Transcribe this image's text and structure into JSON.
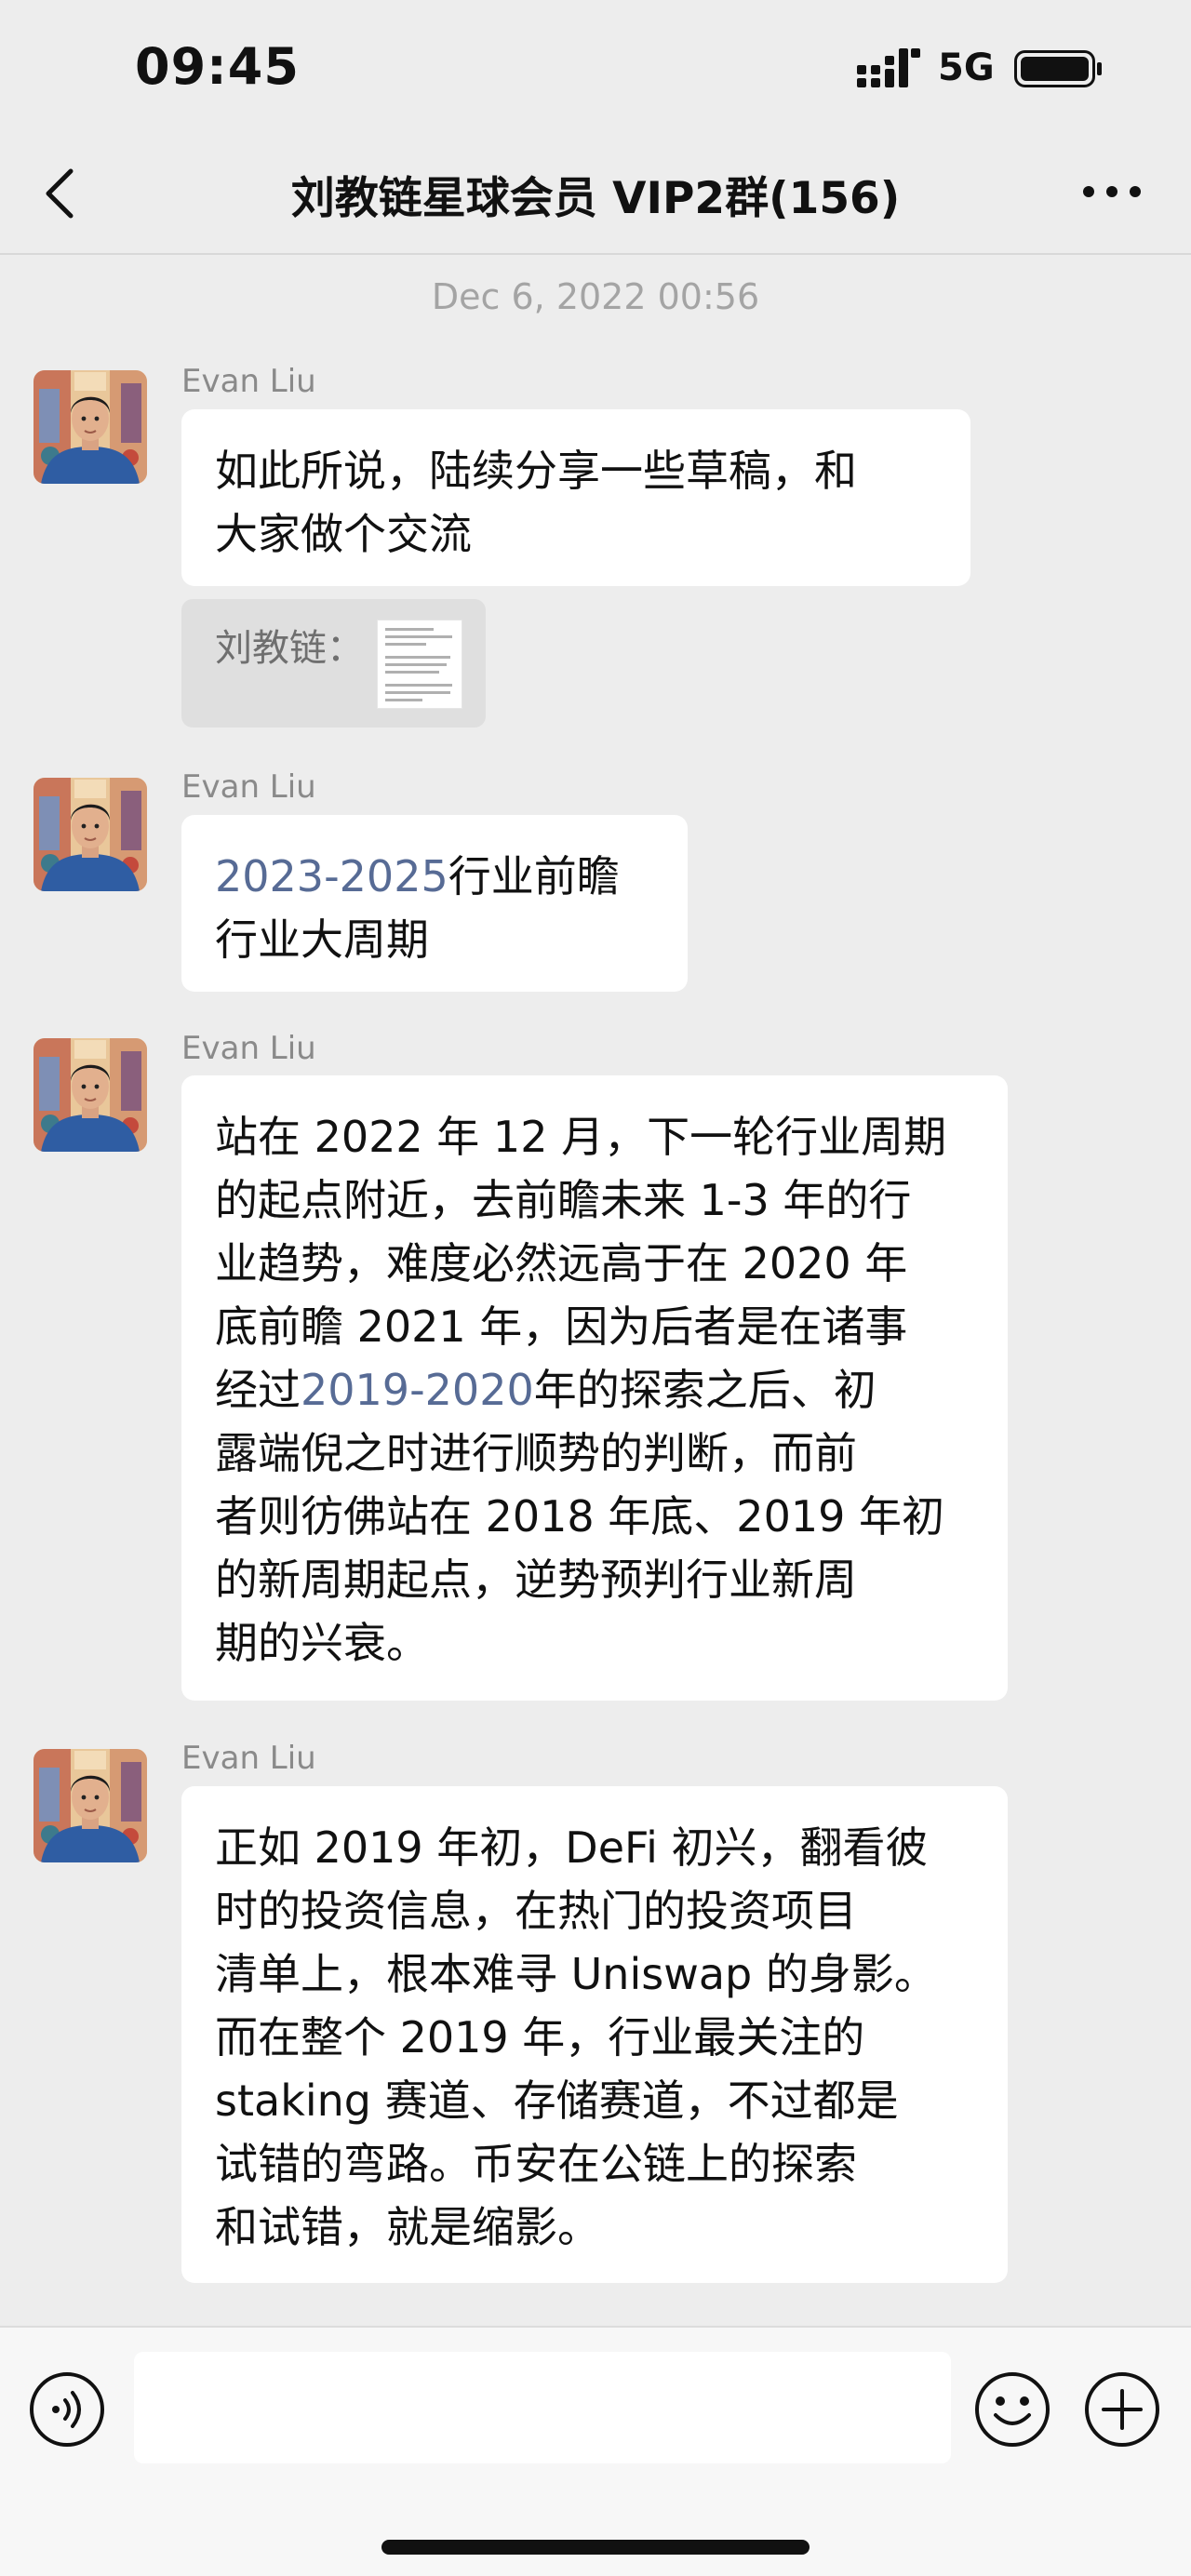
{
  "status_bar": {
    "time": "09:45",
    "network": "5G",
    "icons": [
      "signal-icon",
      "battery-icon"
    ]
  },
  "nav": {
    "title": "刘教链星球会员 VIP2群(156)",
    "icons": [
      "chevron-left-icon",
      "more-icon"
    ]
  },
  "chat": {
    "timestamp": "Dec 6, 2022 00:56",
    "messages": [
      {
        "sender": "Evan Liu",
        "lines": [
          "如此所说，陆续分享一些草稿，和",
          "大家做个交流"
        ],
        "quote_label": "刘教链："
      },
      {
        "sender": "Evan Liu",
        "link": "2023-2025",
        "line1_rest": "行业前瞻",
        "line2": "行业大周期"
      },
      {
        "sender": "Evan Liu",
        "line1": "站在 2022 年 12 月，下一轮行业周期",
        "line2": "的起点附近，去前瞻未来 1-3 年的行",
        "line3": "业趋势，难度必然远高于在 2020 年",
        "line4": "底前瞻 2021 年，因为后者是在诸事",
        "line5_pre": "经过",
        "line5_link": "2019-2020",
        "line5_post": "年的探索之后、初",
        "line6": "露端倪之时进行顺势的判断，而前",
        "line7": "者则彷佛站在 2018 年底、2019 年初",
        "line8": "的新周期起点，逆势预判行业新周",
        "line9": "期的兴衰。"
      },
      {
        "sender": "Evan Liu",
        "lines": [
          "正如 2019 年初，DeFi 初兴，翻看彼",
          "时的投资信息，在热门的投资项目",
          "清单上，根本难寻 Uniswap 的身影。",
          "而在整个 2019 年，行业最关注的",
          "staking 赛道、存储赛道，不过都是",
          "试错的弯路。币安在公链上的探索",
          "和试错，就是缩影。"
        ]
      }
    ]
  },
  "input_bar": {
    "message_value": "",
    "icons": [
      "voice-icon",
      "emoji-icon",
      "plus-icon"
    ]
  },
  "colors": {
    "background": "#ededed",
    "bubble": "#ffffff",
    "link": "#576b95",
    "meta_text": "#a4a4a4"
  }
}
